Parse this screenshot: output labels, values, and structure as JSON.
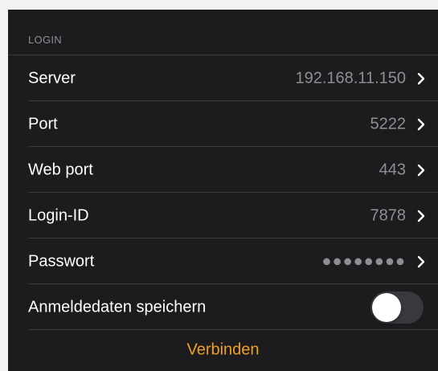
{
  "login": {
    "section_title": "LOGIN",
    "rows": [
      {
        "label": "Server",
        "value": "192.168.11.150"
      },
      {
        "label": "Port",
        "value": "5222"
      },
      {
        "label": "Web port",
        "value": "443"
      },
      {
        "label": "Login-ID",
        "value": "7878"
      },
      {
        "label": "Passwort",
        "value": "●●●●●●●●"
      }
    ],
    "save_credentials": {
      "label": "Anmeldedaten speichern",
      "enabled": false
    },
    "connect_label": "Verbinden"
  },
  "colors": {
    "background": "#1c1c1e",
    "label": "#ffffff",
    "value": "#8e8e93",
    "accent": "#f0a024",
    "divider": "#3a3a3c"
  },
  "icons": {
    "row_disclosure": "chevron-right-icon"
  }
}
